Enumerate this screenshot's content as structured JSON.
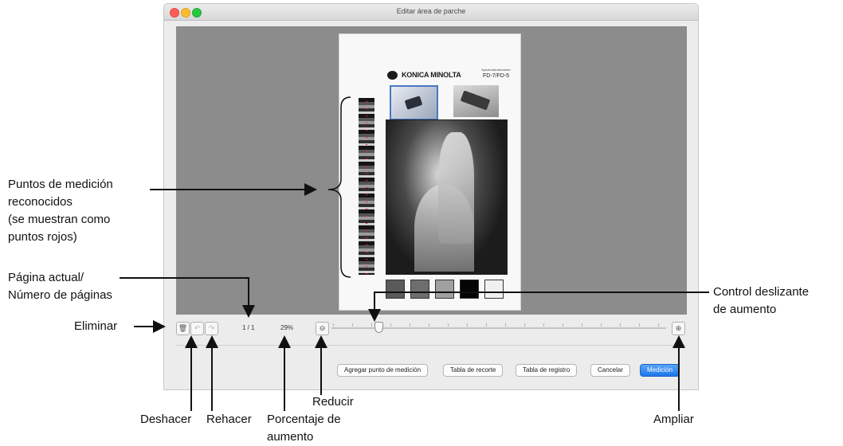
{
  "window": {
    "title": "Editar área de parche"
  },
  "document": {
    "logo_text": "KONICA MINOLTA",
    "model_subtitle": "Spectrodensitometer",
    "model_name": "FD-7/FD-5"
  },
  "toolbar": {
    "page_indicator": "1 / 1",
    "zoom_percent": "29%",
    "slider_level": 0.14,
    "delete_icon": "trash-icon",
    "undo_icon": "undo-icon",
    "redo_icon": "redo-icon",
    "zoom_out_icon": "zoom-out-icon",
    "zoom_in_icon": "zoom-in-icon"
  },
  "buttons": {
    "add_point": "Agregar punto de medición",
    "crop_chart": "Tabla de recorte",
    "register_chart": "Tabla de registro",
    "cancel": "Cancelar",
    "measure": "Medición"
  },
  "colors": {
    "accent": "#1d76e8",
    "measurement_dot": "#e02233",
    "canvas": "#8c8c8c"
  },
  "callouts": {
    "recognized_points_1": "Puntos de medición",
    "recognized_points_2": "reconocidos",
    "recognized_points_3": "(se muestran como",
    "recognized_points_4": "puntos rojos)",
    "current_page_1": "Página actual/",
    "current_page_2": "Número de páginas",
    "delete": "Eliminar",
    "zoom_slider_1": "Control deslizante",
    "zoom_slider_2": "de aumento",
    "undo": "Deshacer",
    "redo": "Rehacer",
    "zoom_percent_1": "Porcentaje de",
    "zoom_percent_2": "aumento",
    "zoom_out": "Reducir",
    "zoom_in": "Ampliar"
  }
}
